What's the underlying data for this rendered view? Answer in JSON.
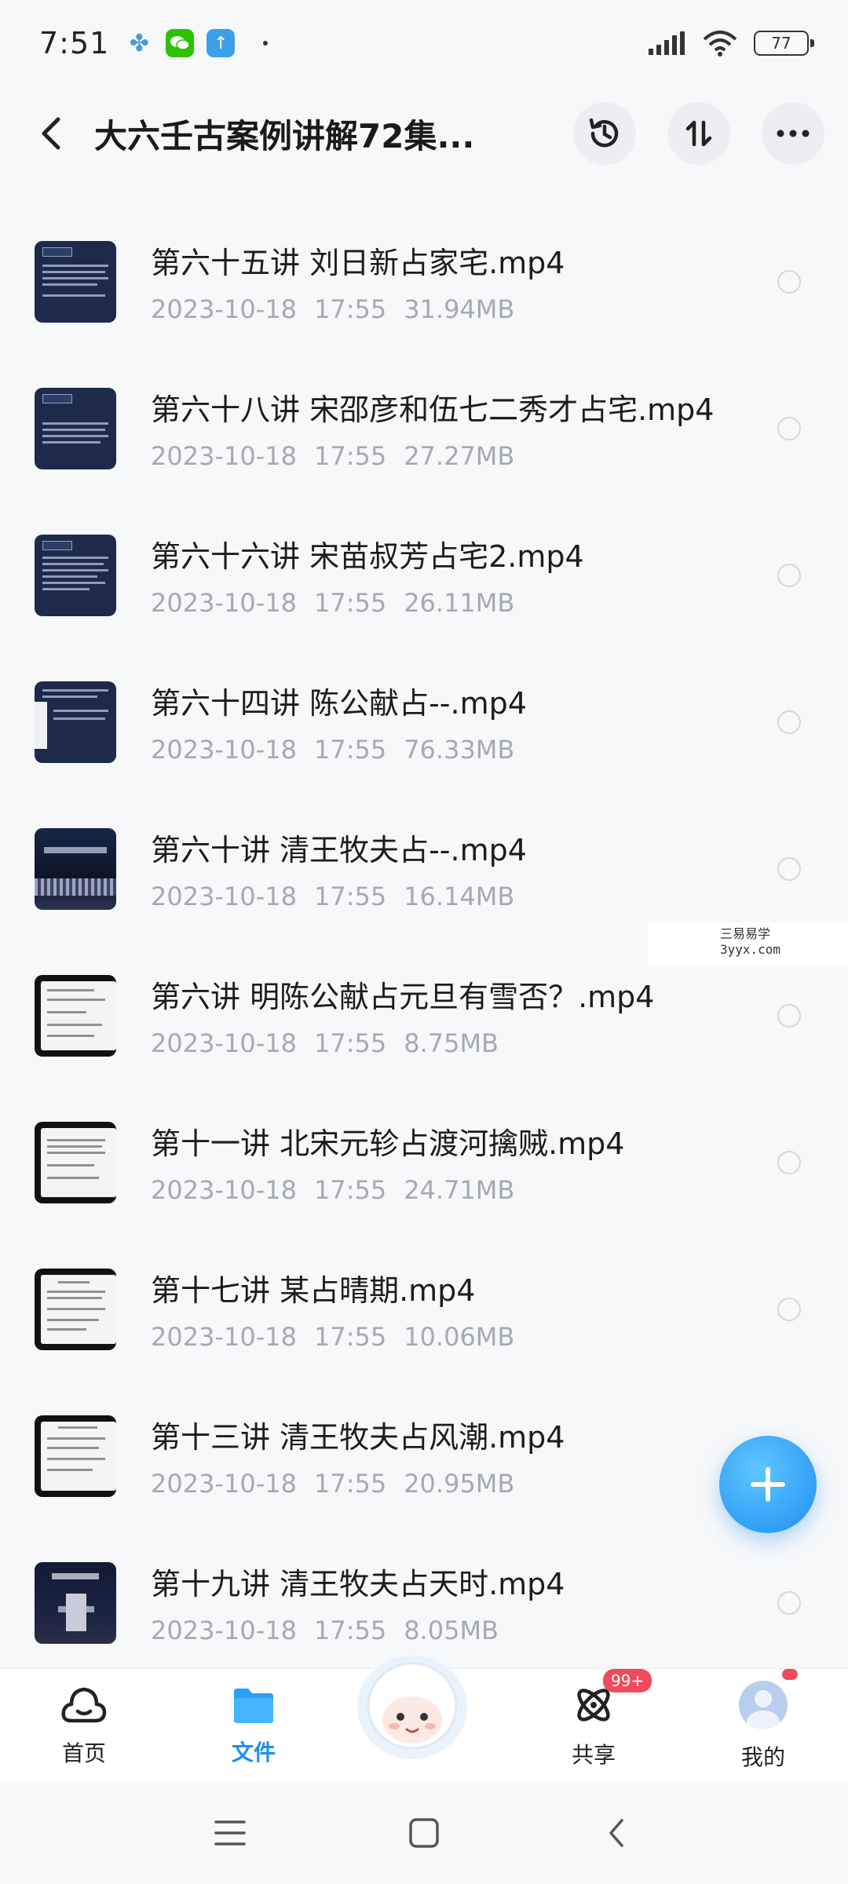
{
  "status_bar": {
    "time": "7:51",
    "battery": "77",
    "app_icons": [
      "clover-icon",
      "wechat-icon",
      "upload-app-icon"
    ]
  },
  "header": {
    "title": "大六壬古案例讲解72集...",
    "icons": [
      "back-arrow-icon",
      "history-icon",
      "sort-icon",
      "more-icon"
    ]
  },
  "files": [
    {
      "name": "第六十五讲 刘日新占家宅.mp4",
      "date": "2023-10-18",
      "time": "17:55",
      "size": "31.94MB"
    },
    {
      "name": "第六十八讲 宋邵彦和伍七二秀才占宅.mp4",
      "date": "2023-10-18",
      "time": "17:55",
      "size": "27.27MB"
    },
    {
      "name": "第六十六讲 宋苗叔芳占宅2.mp4",
      "date": "2023-10-18",
      "time": "17:55",
      "size": "26.11MB"
    },
    {
      "name": "第六十四讲 陈公献占--.mp4",
      "date": "2023-10-18",
      "time": "17:55",
      "size": "76.33MB"
    },
    {
      "name": "第六十讲 清王牧夫占--.mp4",
      "date": "2023-10-18",
      "time": "17:55",
      "size": "16.14MB"
    },
    {
      "name": "第六讲 明陈公献占元旦有雪否？.mp4",
      "date": "2023-10-18",
      "time": "17:55",
      "size": "8.75MB"
    },
    {
      "name": "第十一讲 北宋元轸占渡河擒贼.mp4",
      "date": "2023-10-18",
      "time": "17:55",
      "size": "24.71MB"
    },
    {
      "name": "第十七讲 某占晴期.mp4",
      "date": "2023-10-18",
      "time": "17:55",
      "size": "10.06MB"
    },
    {
      "name": "第十三讲 清王牧夫占风潮.mp4",
      "date": "2023-10-18",
      "time": "17:55",
      "size": "20.95MB"
    },
    {
      "name": "第十九讲 清王牧夫占天时.mp4",
      "date": "2023-10-18",
      "time": "17:55",
      "size": "8.05MB"
    }
  ],
  "watermark": {
    "line1": "三易易学",
    "line2": "3yyx.com"
  },
  "bottom_nav": {
    "home": "首页",
    "files": "文件",
    "share": "共享",
    "share_badge": "99+",
    "mine": "我的"
  },
  "colors": {
    "accent": "#1e8ef0",
    "badge": "#ef4a5d",
    "secondary_text": "#a6a9b0"
  }
}
